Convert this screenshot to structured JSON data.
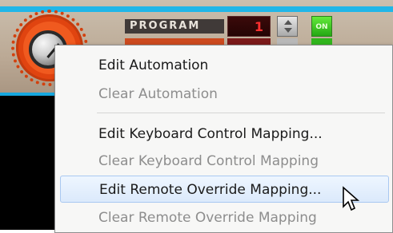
{
  "device": {
    "program_label": "PROGRAM",
    "program_value": "1",
    "on_label": "ON",
    "on_label_2": "ON",
    "accent_color": "#20b6e8"
  },
  "context_menu": {
    "items": [
      {
        "label": "Edit Automation",
        "enabled": true
      },
      {
        "label": "Clear Automation",
        "enabled": false
      },
      {
        "label": "Edit Keyboard Control Mapping...",
        "enabled": true
      },
      {
        "label": "Clear Keyboard Control Mapping",
        "enabled": false
      },
      {
        "label": "Edit Remote Override Mapping...",
        "enabled": true,
        "highlighted": true
      },
      {
        "label": "Clear Remote Override Mapping",
        "enabled": false
      }
    ]
  },
  "icons": {
    "pointer": "mouse-pointer-icon",
    "spinner_up": "chevron-up-icon",
    "spinner_down": "chevron-down-icon"
  }
}
